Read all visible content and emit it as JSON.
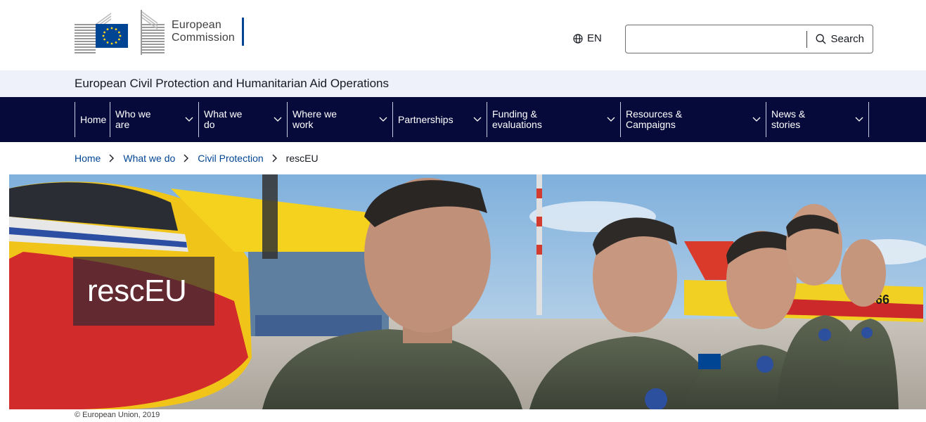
{
  "header": {
    "logo_line1": "European",
    "logo_line2": "Commission",
    "language": "EN",
    "search_placeholder": "",
    "search_label": "Search"
  },
  "site_name": "European Civil Protection and Humanitarian Aid Operations",
  "menu": {
    "items": [
      {
        "label": "Home",
        "has_dropdown": false
      },
      {
        "label_line1": "Who we",
        "label_line2": "are",
        "has_dropdown": true
      },
      {
        "label_line1": "What we",
        "label_line2": "do",
        "has_dropdown": true
      },
      {
        "label_line1": "Where we",
        "label_line2": "work",
        "has_dropdown": true
      },
      {
        "label": "Partnerships",
        "has_dropdown": true
      },
      {
        "label_line1": "Funding &",
        "label_line2": "evaluations",
        "has_dropdown": true
      },
      {
        "label_line1": "Resources &",
        "label_line2": "Campaigns",
        "has_dropdown": true
      },
      {
        "label_line1": "News &",
        "label_line2": "stories",
        "has_dropdown": true
      }
    ]
  },
  "breadcrumb": {
    "items": [
      "Home",
      "What we do",
      "Civil Protection"
    ],
    "current": "rescEU"
  },
  "hero": {
    "title": "rescEU",
    "credit": "© European Union, 2019",
    "aircraft_marking": "66"
  },
  "colors": {
    "menu_bg": "#060a3a",
    "site_bar_bg": "#eef1f9",
    "link": "#004494",
    "eu_blue": "#004494",
    "eu_yellow": "#ffd617"
  },
  "icons": {
    "language": "globe-icon",
    "search": "search-icon",
    "dropdown": "chevron-down-icon",
    "breadcrumb_separator": "chevron-right-icon"
  }
}
